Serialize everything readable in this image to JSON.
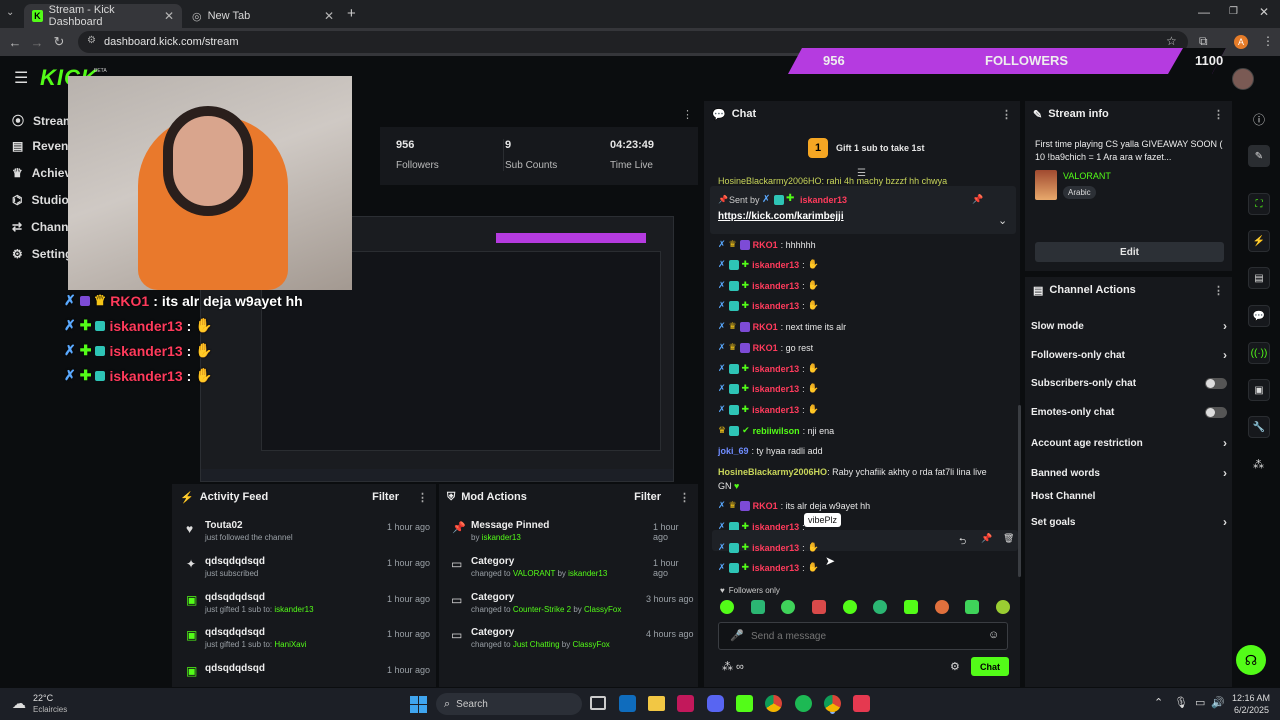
{
  "browser": {
    "tabs": [
      {
        "title": "Stream - Kick Dashboard",
        "active": true
      },
      {
        "title": "New Tab",
        "active": false
      }
    ],
    "url": "dashboard.kick.com/stream",
    "profile_initial": "A"
  },
  "brand": {
    "logo": "KICK",
    "beta": "BETA",
    "accent": "#53fc18"
  },
  "banner": {
    "left_value": "956",
    "label": "FOLLOWERS",
    "right_value": "1100",
    "color": "#b53be0"
  },
  "sidebar": {
    "items": [
      {
        "label": "Stream",
        "icon": "stream-icon"
      },
      {
        "label": "Revenue",
        "icon": "revenue-icon"
      },
      {
        "label": "Achievements",
        "icon": "trophy-icon"
      },
      {
        "label": "Studio",
        "icon": "studio-icon"
      },
      {
        "label": "Channel",
        "icon": "channel-icon"
      },
      {
        "label": "Settings",
        "icon": "gear-icon"
      }
    ]
  },
  "stats": [
    {
      "value": "956",
      "label": "Followers"
    },
    {
      "value": "9",
      "label": "Sub Counts"
    },
    {
      "value": "04:23:49",
      "label": "Time Live"
    }
  ],
  "overlay_chat": [
    {
      "user": "RKO1",
      "sep": " : ",
      "msg": "its alr deja w9ayet hh",
      "user_color": "#ff3b5c"
    },
    {
      "user": "iskander13",
      "sep": " : ",
      "msg": "",
      "user_color": "#ff3b5c"
    },
    {
      "user": "iskander13",
      "sep": " : ",
      "msg": "",
      "user_color": "#ff3b5c"
    },
    {
      "user": "iskander13",
      "sep": " : ",
      "msg": "",
      "user_color": "#ff3b5c"
    }
  ],
  "chat": {
    "title": "Chat",
    "gift_banner": "Gift 1 sub to take 1st",
    "clipped_line": "HosineBlackarmy2006HO: rahi 4h machy bzzzf hh chwya",
    "pinned": {
      "sent_by": "Sent by",
      "user": "iskander13",
      "link": "https://kick.com/karimbejji"
    },
    "messages": [
      {
        "user": "RKO1",
        "text": ": hhhhhh",
        "color": "#ff3b5c"
      },
      {
        "user": "iskander13",
        "text": ":",
        "color": "#ff3b5c"
      },
      {
        "user": "iskander13",
        "text": ":",
        "color": "#ff3b5c"
      },
      {
        "user": "iskander13",
        "text": ":",
        "color": "#ff3b5c"
      },
      {
        "user": "RKO1",
        "text": ": next time its alr",
        "color": "#ff3b5c"
      },
      {
        "user": "RKO1",
        "text": ": go rest",
        "color": "#ff3b5c"
      },
      {
        "user": "iskander13",
        "text": ":",
        "color": "#ff3b5c"
      },
      {
        "user": "iskander13",
        "text": ":",
        "color": "#ff3b5c"
      },
      {
        "user": "iskander13",
        "text": ":",
        "color": "#ff3b5c"
      },
      {
        "user": "rebiiwilson",
        "text": ": nji ena",
        "color": "#53fc18"
      },
      {
        "user": "joki_69",
        "text": ": ty hyaa radli add",
        "color": "#6f8cff"
      }
    ],
    "long_msg_user": "HosineBlackarmy2006HO",
    "long_msg_text": ": Raby ychafiik akhty o rda fat7li lina live GN",
    "tail_messages": [
      {
        "user": "RKO1",
        "text": ": its alr deja w9ayet hh",
        "color": "#ff3b5c"
      },
      {
        "user": "iskander13",
        "text": ":",
        "color": "#ff3b5c"
      },
      {
        "user": "iskander13",
        "text": ":",
        "color": "#ff3b5c"
      },
      {
        "user": "iskander13",
        "text": ":",
        "color": "#ff3b5c"
      }
    ],
    "tooltip": "vibePlz",
    "followers_only": "Followers only",
    "placeholder": "Send a message",
    "send_label": "Chat"
  },
  "activity": {
    "title": "Activity Feed",
    "filter": "Filter",
    "items": [
      {
        "name": "Touta02",
        "sub": "just followed the channel",
        "time": "1 hour ago",
        "icon": "heart-icon",
        "target": ""
      },
      {
        "name": "qdsqdqdsqd",
        "sub": "just subscribed",
        "time": "1 hour ago",
        "icon": "star-icon",
        "target": ""
      },
      {
        "name": "qdsqdqdsqd",
        "sub": "just gifted 1 sub to:",
        "time": "1 hour ago",
        "icon": "gift-icon",
        "target": "iskander13"
      },
      {
        "name": "qdsqdqdsqd",
        "sub": "just gifted 1 sub to:",
        "time": "1 hour ago",
        "icon": "gift-icon",
        "target": "HaniXavi"
      },
      {
        "name": "qdsqdqdsqd",
        "sub": "",
        "time": "1 hour ago",
        "icon": "gift-icon",
        "target": ""
      }
    ]
  },
  "mod_actions": {
    "title": "Mod Actions",
    "filter": "Filter",
    "items": [
      {
        "title": "Message Pinned",
        "pre": "by",
        "a": "iskander13",
        "mid": "",
        "b": "",
        "time": "1 hour ago",
        "icon": "pin-icon"
      },
      {
        "title": "Category",
        "pre": "changed to",
        "a": "VALORANT",
        "mid": "by",
        "b": "iskander13",
        "time": "1 hour ago",
        "icon": "category-icon"
      },
      {
        "title": "Category",
        "pre": "changed to",
        "a": "Counter-Strike 2",
        "mid": "by",
        "b": "ClassyFox",
        "time": "3 hours ago",
        "icon": "category-icon"
      },
      {
        "title": "Category",
        "pre": "changed to",
        "a": "Just Chatting",
        "mid": "by",
        "b": "ClassyFox",
        "time": "4 hours ago",
        "icon": "category-icon"
      }
    ]
  },
  "stream_info": {
    "title": "Stream info",
    "stream_title": "First time playing CS yalla GIVEAWAY SOON ( 10 !ba9chich = 1 Ara ara w fazet...",
    "category": "VALORANT",
    "language": "Arabic",
    "edit": "Edit"
  },
  "channel_actions": {
    "title": "Channel Actions",
    "items": [
      {
        "label": "Slow mode",
        "control": "chevron"
      },
      {
        "label": "Followers-only chat",
        "control": "chevron"
      },
      {
        "label": "Subscribers-only chat",
        "control": "toggle"
      },
      {
        "label": "Emotes-only chat",
        "control": "toggle"
      },
      {
        "label": "Account age restriction",
        "control": "chevron"
      },
      {
        "label": "Banned words",
        "control": "chevron"
      },
      {
        "label": "Host Channel",
        "control": "none"
      },
      {
        "label": "Set goals",
        "control": "chevron"
      }
    ]
  },
  "taskbar": {
    "weather_temp": "22°C",
    "weather_desc": "Eclaircies",
    "search": "Search",
    "time": "12:16 AM",
    "date": "6/2/2025"
  }
}
